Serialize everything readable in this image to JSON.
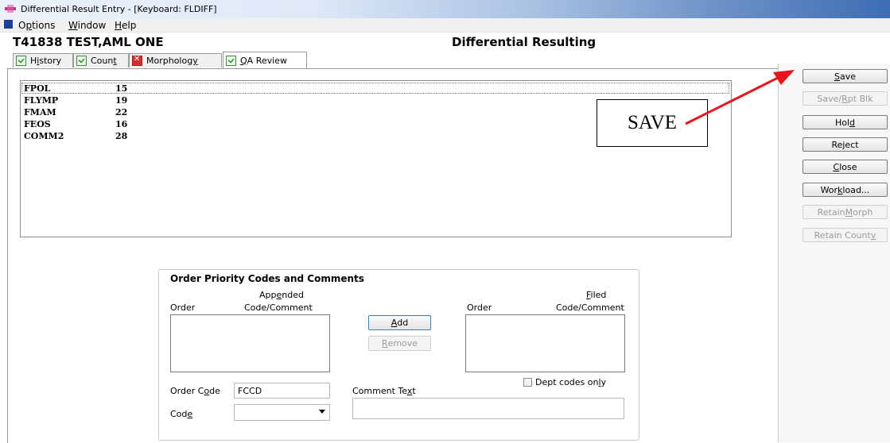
{
  "window": {
    "title": "Differential Result Entry - [Keyboard: FLDIFF]"
  },
  "menu": [
    {
      "label": "Options",
      "mnemonic_index": 1
    },
    {
      "label": "Window",
      "mnemonic_index": 0
    },
    {
      "label": "Help",
      "mnemonic_index": 0
    }
  ],
  "header": {
    "patient": "T41838 TEST,AML ONE",
    "screen_title": "Differential Resulting"
  },
  "tabs": [
    {
      "pre": "H",
      "u": "i",
      "post": "story",
      "state": "ok"
    },
    {
      "pre": "Coun",
      "u": "t",
      "post": "",
      "state": "ok"
    },
    {
      "pre": "Morpholog",
      "u": "y",
      "post": "",
      "state": "error"
    },
    {
      "pre": "",
      "u": "Q",
      "post": "A Review",
      "state": "ok",
      "active": true
    }
  ],
  "results": [
    {
      "code": "FPOL",
      "value": "15"
    },
    {
      "code": "FLYMP",
      "value": "19"
    },
    {
      "code": "FMAM",
      "value": "22"
    },
    {
      "code": "FEOS",
      "value": "16"
    },
    {
      "code": "COMM2",
      "value": "28"
    }
  ],
  "annotation": {
    "text": "SAVE",
    "color": "#e8141b"
  },
  "buttons": [
    {
      "pre": "",
      "u": "S",
      "post": "ave",
      "enabled": true
    },
    {
      "pre": "Save/",
      "u": "R",
      "post": "pt Blk",
      "enabled": false
    },
    {
      "pre": "Hol",
      "u": "d",
      "post": "",
      "enabled": true
    },
    {
      "pre": "Re",
      "u": "j",
      "post": "ect",
      "enabled": true
    },
    {
      "pre": "",
      "u": "C",
      "post": "lose",
      "enabled": true
    },
    {
      "pre": "Wor",
      "u": "k",
      "post": "load...",
      "enabled": true
    },
    {
      "pre": "Retain ",
      "u": "M",
      "post": "orph",
      "enabled": false
    },
    {
      "pre": "Retain Count ",
      "u": "v",
      "post": "",
      "enabled": false
    }
  ],
  "order_priority": {
    "title": "Order Priority Codes and Comments",
    "appended_heading": {
      "pre": "App",
      "u": "e",
      "post": "nded"
    },
    "code_comment": "Code/Comment",
    "order": "Order",
    "filed_heading": {
      "pre": "",
      "u": "F",
      "post": "iled"
    },
    "add": {
      "pre": "",
      "u": "A",
      "post": "dd"
    },
    "remove": {
      "pre": "",
      "u": "R",
      "post": "emove"
    },
    "dept_codes_only": {
      "pre": "Dept codes on",
      "u": "l",
      "post": "y"
    },
    "order_code_label": {
      "pre": "Order C",
      "u": "o",
      "post": "de"
    },
    "order_code_value": "FCCD",
    "comment_text_label": {
      "pre": "Comment Te",
      "u": "x",
      "post": "t"
    },
    "code_label": {
      "pre": "Cod",
      "u": "e",
      "post": ""
    },
    "code_value": ""
  }
}
